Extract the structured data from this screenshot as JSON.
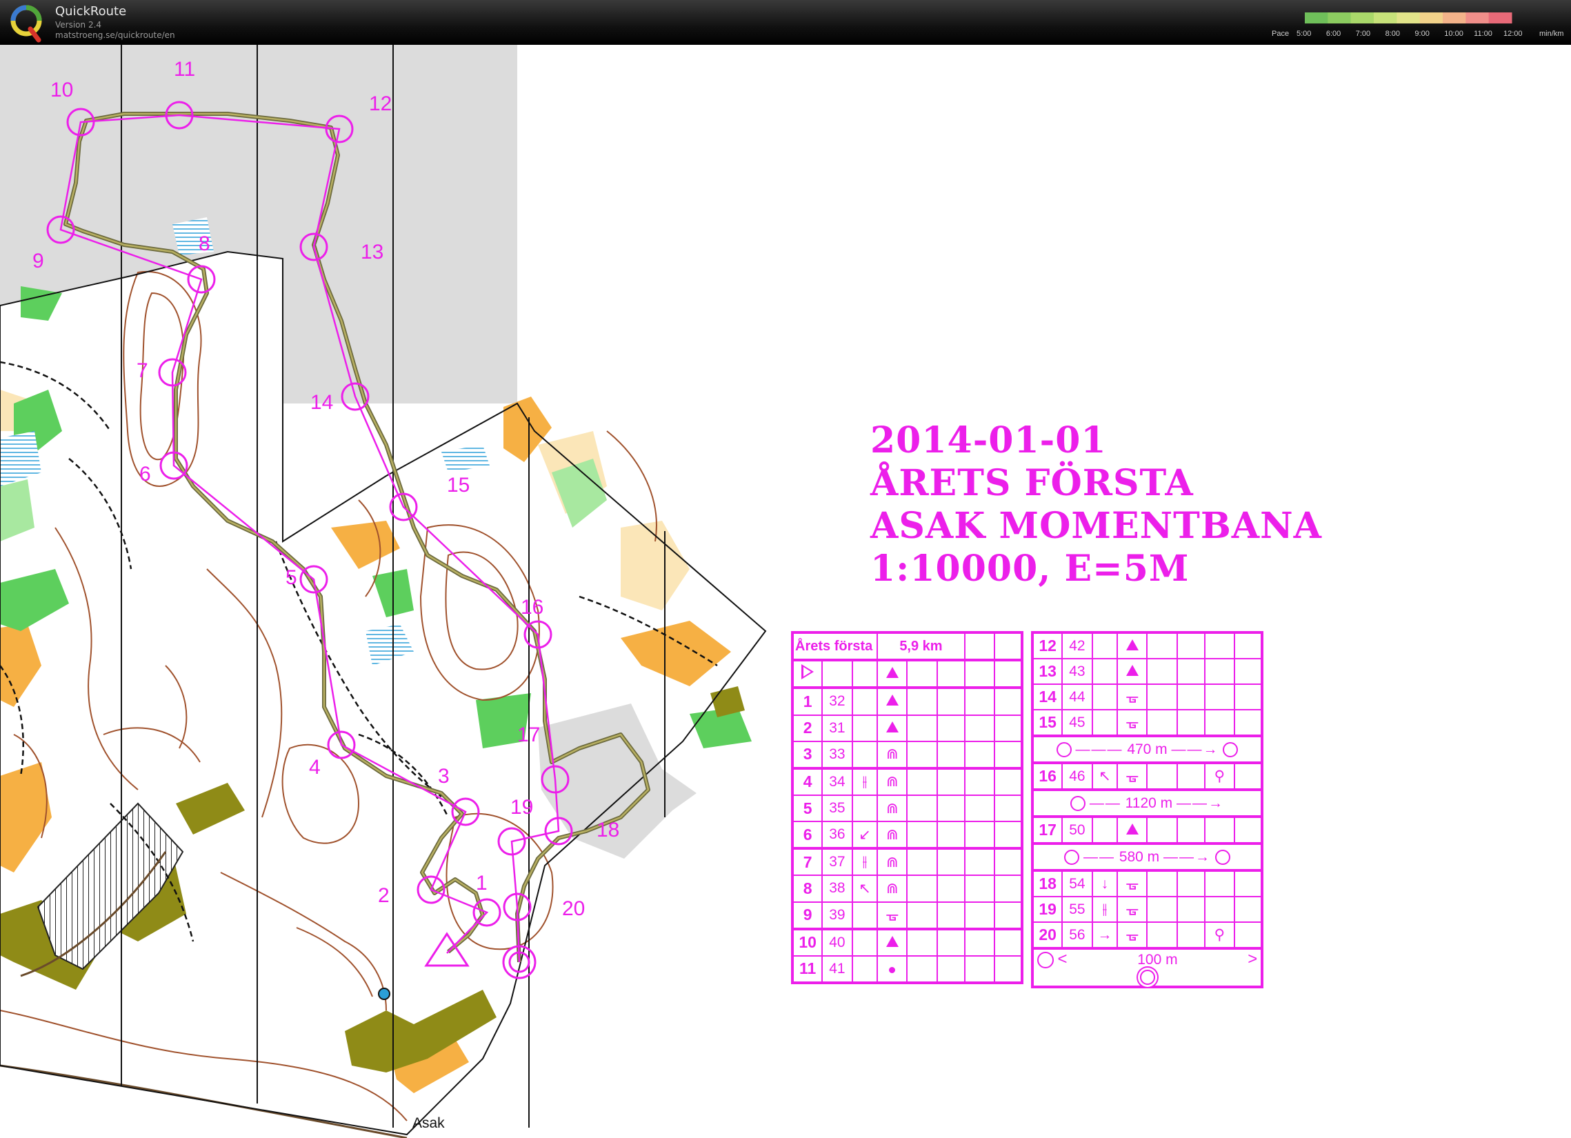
{
  "app": {
    "name": "QuickRoute",
    "version": "Version 2.4",
    "url": "matstroeng.se/quickroute/en"
  },
  "pace_legend": {
    "label": "Pace",
    "ticks": [
      "5:00",
      "6:00",
      "7:00",
      "8:00",
      "9:00",
      "10:00",
      "11:00",
      "12:00"
    ],
    "unit": "min/km",
    "colors": [
      "#6fbf5a",
      "#8ccc60",
      "#a9d86a",
      "#c7e27a",
      "#e2e48a",
      "#f2d28a",
      "#f3b38a",
      "#f08f8a",
      "#e86a78"
    ]
  },
  "map": {
    "place_label": "Asak",
    "course_color": "#ec1fea",
    "controls": [
      {
        "label": "1"
      },
      {
        "label": "2"
      },
      {
        "label": "3"
      },
      {
        "label": "4"
      },
      {
        "label": "5"
      },
      {
        "label": "6"
      },
      {
        "label": "7"
      },
      {
        "label": "8"
      },
      {
        "label": "9"
      },
      {
        "label": "10"
      },
      {
        "label": "11"
      },
      {
        "label": "12"
      },
      {
        "label": "13"
      },
      {
        "label": "14"
      },
      {
        "label": "15"
      },
      {
        "label": "16"
      },
      {
        "label": "17"
      },
      {
        "label": "18"
      },
      {
        "label": "19"
      },
      {
        "label": "20"
      }
    ]
  },
  "event": {
    "title_lines": [
      "2014-01-01",
      "ÅRETS FÖRSTA",
      "ASAK MOMENTBANA",
      "1:10000, E=5M"
    ]
  },
  "control_descriptions": {
    "course_name": "Årets första",
    "course_length": "5,9 km",
    "left_rows": [
      {
        "num": "1",
        "code": "32",
        "col3": "",
        "feature": "triangle"
      },
      {
        "num": "2",
        "code": "31",
        "col3": "",
        "feature": "triangle"
      },
      {
        "num": "3",
        "code": "33",
        "col3": "",
        "feature": "⋒"
      },
      {
        "num": "4",
        "code": "34",
        "col3": "⫲",
        "feature": "⋒"
      },
      {
        "num": "5",
        "code": "35",
        "col3": "",
        "feature": "⋒"
      },
      {
        "num": "6",
        "code": "36",
        "col3": "↙",
        "feature": "⋒"
      },
      {
        "num": "7",
        "code": "37",
        "col3": "⫲",
        "feature": "⋒"
      },
      {
        "num": "8",
        "code": "38",
        "col3": "↖",
        "feature": "⋒"
      },
      {
        "num": "9",
        "code": "39",
        "col3": "",
        "feature": "ᚗ"
      },
      {
        "num": "10",
        "code": "40",
        "col3": "",
        "feature": "triangle"
      },
      {
        "num": "11",
        "code": "41",
        "col3": "",
        "feature": "dot"
      }
    ],
    "right_rows_a": [
      {
        "num": "12",
        "code": "42",
        "col3": "",
        "feature": "triangle"
      },
      {
        "num": "13",
        "code": "43",
        "col3": "",
        "feature": "triangle"
      },
      {
        "num": "14",
        "code": "44",
        "col3": "",
        "feature": "ᚗ"
      },
      {
        "num": "15",
        "code": "45",
        "col3": "",
        "feature": "ᚗ"
      }
    ],
    "leg_1": "470 m",
    "row_16": {
      "num": "16",
      "code": "46",
      "col3": "↖",
      "feature": "ᚗ",
      "extra": "⚲"
    },
    "leg_2": "1120 m",
    "row_17": {
      "num": "17",
      "code": "50",
      "col3": "",
      "feature": "triangle"
    },
    "leg_3": "580 m",
    "right_rows_b": [
      {
        "num": "18",
        "code": "54",
        "col3": "↓",
        "feature": "ᚗ",
        "extra": ""
      },
      {
        "num": "19",
        "code": "55",
        "col3": "⫲",
        "feature": "ᚗ",
        "extra": ""
      },
      {
        "num": "20",
        "code": "56",
        "col3": "→",
        "feature": "ᚗ",
        "extra": "⚲"
      }
    ],
    "leg_finish": "100 m"
  }
}
